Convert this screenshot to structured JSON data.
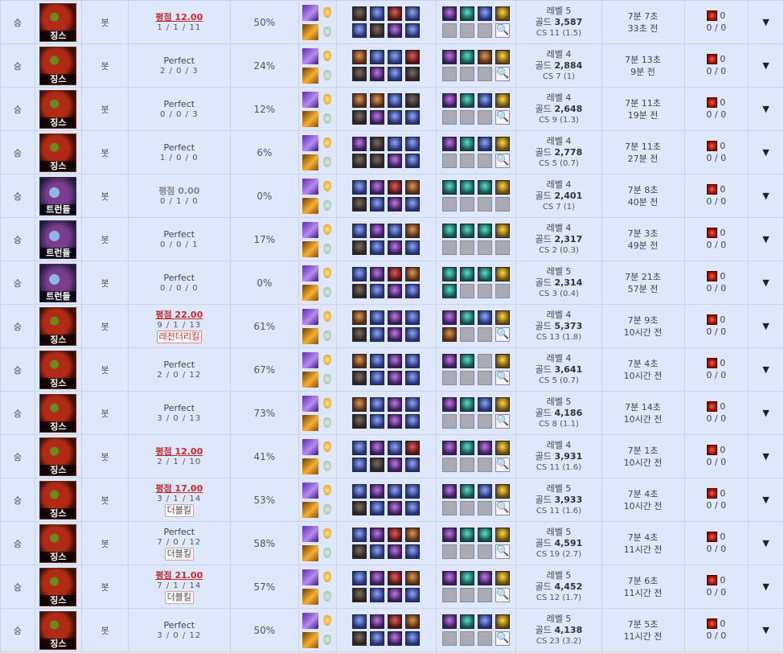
{
  "rows": [
    {
      "result": "승",
      "champion": "징스",
      "champ_icon": "jinx",
      "position": "봇",
      "score_type": "avg",
      "score": "평점 12.00",
      "kda": "1 / 1 / 11",
      "badge": "",
      "badge_style": "",
      "kill_participation": "50%",
      "team": [
        "dark",
        "blue",
        "red",
        "blue",
        "blue",
        "dark",
        "purple",
        "blue"
      ],
      "items": [
        "purple",
        "teal",
        "blue",
        "gold",
        "empty",
        "empty",
        "empty",
        "search"
      ],
      "level": "레벨 5",
      "gold_label": "골드",
      "gold": "3,587",
      "cs": "CS 11 (1.5)",
      "time": "7분 7초",
      "ago": "33초 전",
      "wards_placed": "0",
      "wards_kd": "0 / 0"
    },
    {
      "result": "승",
      "champion": "징스",
      "champ_icon": "jinx",
      "position": "봇",
      "score_type": "perfect",
      "score": "Perfect",
      "kda": "2 / 0 / 3",
      "badge": "",
      "badge_style": "",
      "kill_participation": "24%",
      "team": [
        "brown",
        "blue",
        "blue",
        "red",
        "dark",
        "purple",
        "blue",
        "dark"
      ],
      "items": [
        "purple",
        "teal",
        "brown",
        "gold",
        "empty",
        "empty",
        "empty",
        "search"
      ],
      "level": "레벨 4",
      "gold_label": "골드",
      "gold": "2,884",
      "cs": "CS 7 (1)",
      "time": "7분 13초",
      "ago": "9분 전",
      "wards_placed": "0",
      "wards_kd": "0 / 0"
    },
    {
      "result": "승",
      "champion": "징스",
      "champ_icon": "jinx",
      "position": "봇",
      "score_type": "perfect",
      "score": "Perfect",
      "kda": "0 / 0 / 3",
      "badge": "",
      "badge_style": "",
      "kill_participation": "12%",
      "team": [
        "brown",
        "brown",
        "blue",
        "dark",
        "dark",
        "purple",
        "blue",
        "blue"
      ],
      "items": [
        "purple",
        "teal",
        "blue",
        "gold",
        "empty",
        "empty",
        "empty",
        "search"
      ],
      "level": "레벨 4",
      "gold_label": "골드",
      "gold": "2,648",
      "cs": "CS 9 (1.3)",
      "time": "7분 11초",
      "ago": "19분 전",
      "wards_placed": "0",
      "wards_kd": "0 / 0"
    },
    {
      "result": "승",
      "champion": "징스",
      "champ_icon": "jinx",
      "position": "봇",
      "score_type": "perfect",
      "score": "Perfect",
      "kda": "1 / 0 / 0",
      "badge": "",
      "badge_style": "",
      "kill_participation": "6%",
      "team": [
        "purple",
        "dark",
        "blue",
        "blue",
        "dark",
        "dark",
        "purple",
        "blue"
      ],
      "items": [
        "purple",
        "teal",
        "blue",
        "gold",
        "empty",
        "empty",
        "empty",
        "search"
      ],
      "level": "레벨 4",
      "gold_label": "골드",
      "gold": "2,778",
      "cs": "CS 5 (0.7)",
      "time": "7분 11초",
      "ago": "27분 전",
      "wards_placed": "0",
      "wards_kd": "0 / 0"
    },
    {
      "result": "승",
      "champion": "트런들",
      "champ_icon": "trundle",
      "position": "봇",
      "score_type": "avg0",
      "score": "평점 0.00",
      "kda": "0 / 1 / 0",
      "badge": "",
      "badge_style": "",
      "kill_participation": "0%",
      "team": [
        "blue",
        "purple",
        "red",
        "brown",
        "dark",
        "blue",
        "purple",
        "blue"
      ],
      "items": [
        "teal",
        "teal",
        "teal",
        "gold",
        "empty",
        "empty",
        "empty",
        "empty"
      ],
      "level": "레벨 4",
      "gold_label": "골드",
      "gold": "2,401",
      "cs": "CS 7 (1)",
      "time": "7분 8초",
      "ago": "40분 전",
      "wards_placed": "0",
      "wards_kd": "0 / 0"
    },
    {
      "result": "승",
      "champion": "트런들",
      "champ_icon": "trundle",
      "position": "봇",
      "score_type": "perfect",
      "score": "Perfect",
      "kda": "0 / 0 / 1",
      "badge": "",
      "badge_style": "",
      "kill_participation": "17%",
      "team": [
        "blue",
        "purple",
        "blue",
        "brown",
        "dark",
        "blue",
        "purple",
        "blue"
      ],
      "items": [
        "teal",
        "teal",
        "teal",
        "gold",
        "empty",
        "empty",
        "empty",
        "empty"
      ],
      "level": "레벨 4",
      "gold_label": "골드",
      "gold": "2,317",
      "cs": "CS 2 (0.3)",
      "time": "7분 3초",
      "ago": "49분 전",
      "wards_placed": "0",
      "wards_kd": "0 / 0"
    },
    {
      "result": "승",
      "champion": "트런들",
      "champ_icon": "trundle",
      "position": "봇",
      "score_type": "perfect",
      "score": "Perfect",
      "kda": "0 / 0 / 0",
      "badge": "",
      "badge_style": "",
      "kill_participation": "0%",
      "team": [
        "blue",
        "purple",
        "red",
        "brown",
        "dark",
        "blue",
        "purple",
        "blue"
      ],
      "items": [
        "teal",
        "teal",
        "teal",
        "gold",
        "teal",
        "empty",
        "empty",
        "empty"
      ],
      "level": "레벨 5",
      "gold_label": "골드",
      "gold": "2,314",
      "cs": "CS 3 (0.4)",
      "time": "7분 21초",
      "ago": "57분 전",
      "wards_placed": "0",
      "wards_kd": "0 / 0"
    },
    {
      "result": "승",
      "champion": "징스",
      "champ_icon": "jinx",
      "position": "봇",
      "score_type": "avg",
      "score": "평점 22.00",
      "kda": "9 / 1 / 13",
      "badge": "레전더리킬",
      "badge_style": "red",
      "kill_participation": "61%",
      "team": [
        "brown",
        "blue",
        "purple",
        "blue",
        "dark",
        "blue",
        "purple",
        "blue"
      ],
      "items": [
        "purple",
        "teal",
        "blue",
        "gold",
        "brown",
        "empty",
        "empty",
        "search"
      ],
      "level": "레벨 4",
      "gold_label": "골드",
      "gold": "5,373",
      "cs": "CS 13 (1.8)",
      "time": "7분 9초",
      "ago": "10시간 전",
      "wards_placed": "0",
      "wards_kd": "0 / 0"
    },
    {
      "result": "승",
      "champion": "징스",
      "champ_icon": "jinx",
      "position": "봇",
      "score_type": "perfect",
      "score": "Perfect",
      "kda": "2 / 0 / 12",
      "badge": "",
      "badge_style": "",
      "kill_participation": "67%",
      "team": [
        "brown",
        "blue",
        "purple",
        "blue",
        "dark",
        "blue",
        "purple",
        "blue"
      ],
      "items": [
        "purple",
        "teal",
        "empty",
        "gold",
        "empty",
        "empty",
        "empty",
        "search"
      ],
      "level": "레벨 4",
      "gold_label": "골드",
      "gold": "3,641",
      "cs": "CS 5 (0.7)",
      "time": "7분 4초",
      "ago": "10시간 전",
      "wards_placed": "0",
      "wards_kd": "0 / 0"
    },
    {
      "result": "승",
      "champion": "징스",
      "champ_icon": "jinx",
      "position": "봇",
      "score_type": "perfect",
      "score": "Perfect",
      "kda": "3 / 0 / 13",
      "badge": "",
      "badge_style": "",
      "kill_participation": "73%",
      "team": [
        "brown",
        "blue",
        "purple",
        "blue",
        "dark",
        "blue",
        "purple",
        "blue"
      ],
      "items": [
        "purple",
        "teal",
        "blue",
        "gold",
        "empty",
        "empty",
        "empty",
        "search"
      ],
      "level": "레벨 5",
      "gold_label": "골드",
      "gold": "4,186",
      "cs": "CS 8 (1.1)",
      "time": "7분 14초",
      "ago": "10시간 전",
      "wards_placed": "0",
      "wards_kd": "0 / 0"
    },
    {
      "result": "승",
      "champion": "징스",
      "champ_icon": "jinx",
      "position": "봇",
      "score_type": "avg",
      "score": "평점 12.00",
      "kda": "2 / 1 / 10",
      "badge": "",
      "badge_style": "",
      "kill_participation": "41%",
      "team": [
        "blue",
        "purple",
        "blue",
        "red",
        "blue",
        "dark",
        "purple",
        "blue"
      ],
      "items": [
        "purple",
        "teal",
        "purple",
        "gold",
        "empty",
        "empty",
        "empty",
        "search"
      ],
      "level": "레벨 4",
      "gold_label": "골드",
      "gold": "3,931",
      "cs": "CS 11 (1.6)",
      "time": "7분 1초",
      "ago": "10시간 전",
      "wards_placed": "0",
      "wards_kd": "0 / 0"
    },
    {
      "result": "승",
      "champion": "징스",
      "champ_icon": "jinx",
      "position": "봇",
      "score_type": "avg",
      "score": "평점 17.00",
      "kda": "3 / 1 / 14",
      "badge": "더블킬",
      "badge_style": "",
      "kill_participation": "53%",
      "team": [
        "blue",
        "purple",
        "blue",
        "blue",
        "dark",
        "blue",
        "purple",
        "blue"
      ],
      "items": [
        "purple",
        "teal",
        "blue",
        "gold",
        "empty",
        "empty",
        "empty",
        "search"
      ],
      "level": "레벨 5",
      "gold_label": "골드",
      "gold": "3,933",
      "cs": "CS 11 (1.6)",
      "time": "7분 4초",
      "ago": "10시간 전",
      "wards_placed": "0",
      "wards_kd": "0 / 0"
    },
    {
      "result": "승",
      "champion": "징스",
      "champ_icon": "jinx",
      "position": "봇",
      "score_type": "perfect",
      "score": "Perfect",
      "kda": "7 / 0 / 12",
      "badge": "더블킬",
      "badge_style": "",
      "kill_participation": "58%",
      "team": [
        "blue",
        "purple",
        "red",
        "brown",
        "dark",
        "blue",
        "purple",
        "blue"
      ],
      "items": [
        "purple",
        "teal",
        "teal",
        "gold",
        "empty",
        "empty",
        "empty",
        "search"
      ],
      "level": "레벨 5",
      "gold_label": "골드",
      "gold": "4,591",
      "cs": "CS 19 (2.7)",
      "time": "7분 4초",
      "ago": "11시간 전",
      "wards_placed": "0",
      "wards_kd": "0 / 0"
    },
    {
      "result": "승",
      "champion": "징스",
      "champ_icon": "jinx",
      "position": "봇",
      "score_type": "avg",
      "score": "평점 21.00",
      "kda": "7 / 1 / 14",
      "badge": "더블킬",
      "badge_style": "",
      "kill_participation": "57%",
      "team": [
        "blue",
        "purple",
        "red",
        "brown",
        "dark",
        "blue",
        "purple",
        "blue"
      ],
      "items": [
        "purple",
        "teal",
        "purple",
        "gold",
        "empty",
        "empty",
        "empty",
        "search"
      ],
      "level": "레벨 5",
      "gold_label": "골드",
      "gold": "4,452",
      "cs": "CS 12 (1.7)",
      "time": "7분 6초",
      "ago": "11시간 전",
      "wards_placed": "0",
      "wards_kd": "0 / 0"
    },
    {
      "result": "승",
      "champion": "징스",
      "champ_icon": "jinx",
      "position": "봇",
      "score_type": "perfect",
      "score": "Perfect",
      "kda": "3 / 0 / 12",
      "badge": "",
      "badge_style": "",
      "kill_participation": "50%",
      "team": [
        "blue",
        "purple",
        "red",
        "brown",
        "dark",
        "blue",
        "purple",
        "blue"
      ],
      "items": [
        "purple",
        "teal",
        "blue",
        "gold",
        "empty",
        "empty",
        "empty",
        "search"
      ],
      "level": "레벨 5",
      "gold_label": "골드",
      "gold": "4,138",
      "cs": "CS 23 (3.2)",
      "time": "7분 5초",
      "ago": "11시간 전",
      "wards_placed": "0",
      "wards_kd": "0 / 0"
    }
  ],
  "icons": {
    "expand": "▼",
    "search": "🔍",
    "ward": "ward-icon",
    "spell_a": "spell-purple",
    "spell_b": "spell-orange"
  }
}
